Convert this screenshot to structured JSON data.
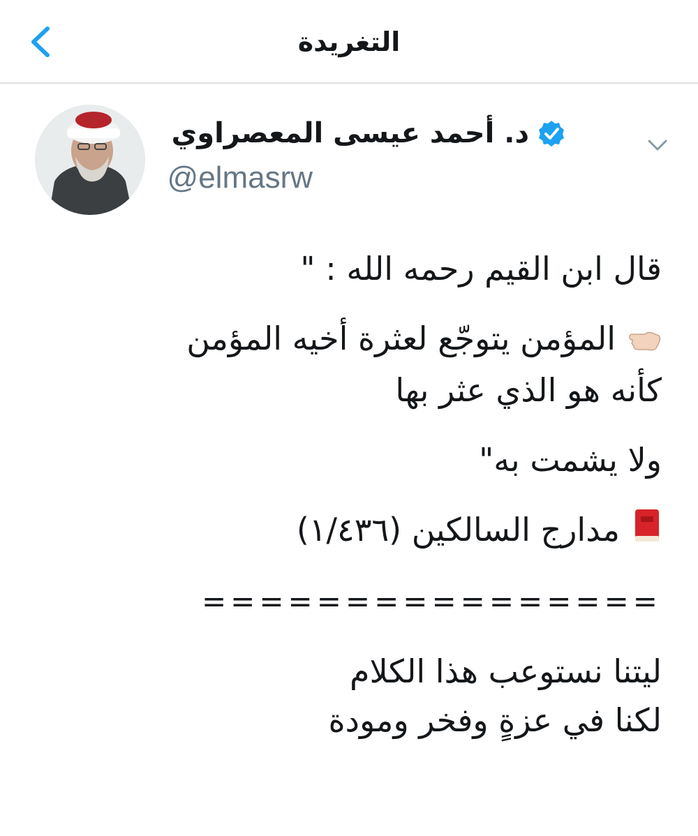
{
  "nav": {
    "title": "التغريدة",
    "back_icon": "chevron-left-icon",
    "accent_color": "#1da1f2"
  },
  "author": {
    "name": "د. أحمد عيسى المعصراوي",
    "handle": "@elmasrw",
    "verified": true,
    "verified_icon": "verified-badge-icon",
    "menu_icon": "chevron-down-icon"
  },
  "tweet": {
    "line1": "قال ابن القيم رحمه الله : \"",
    "line2": "المؤمن يتوجّع لعثرة أخيه المؤمن",
    "line3": "كأنه هو الذي عثر بها",
    "line4": "ولا يشمت به\"",
    "line5": "مدارج السالكين (١/٤٣٦)",
    "line6": "================",
    "line7": "ليتنا نستوعب هذا الكلام",
    "line8": "لكنا في عزةٍ وفخر ومودة",
    "hand_icon": "pointing-hand-icon",
    "book_icon": "red-book-icon"
  }
}
